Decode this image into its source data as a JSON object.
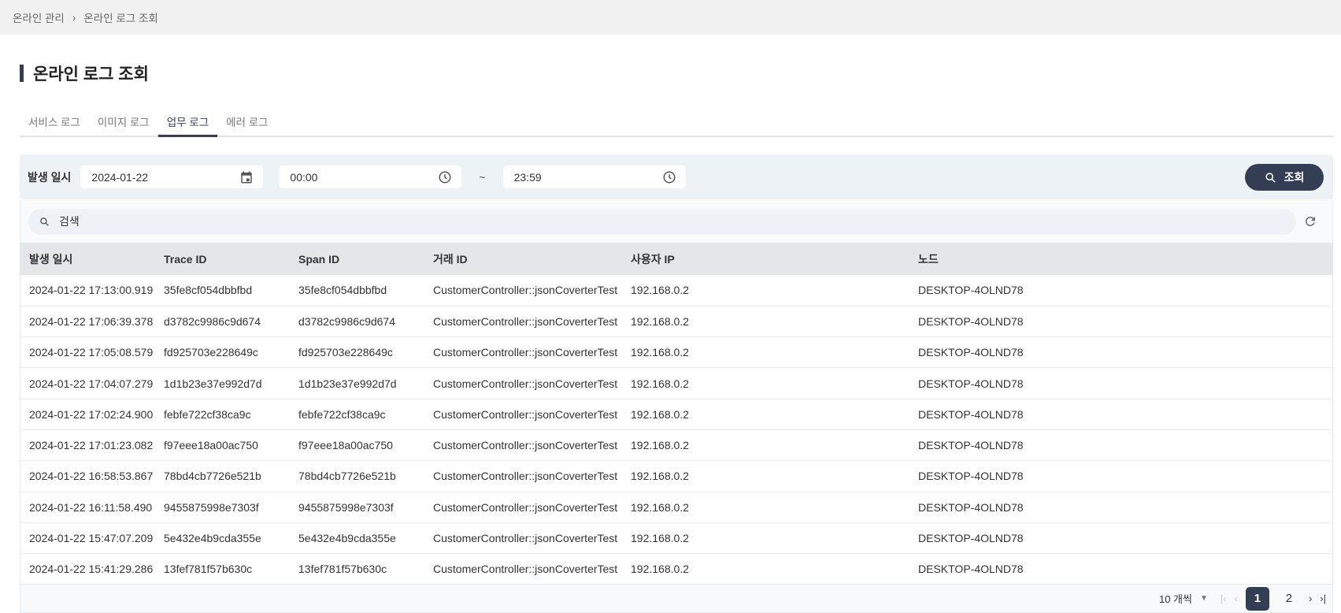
{
  "breadcrumb": {
    "parent": "온라인 관리",
    "current": "온라인 로그 조회"
  },
  "page_title": "온라인 로그 조회",
  "tabs": [
    {
      "label": "서비스 로그"
    },
    {
      "label": "이미지 로그"
    },
    {
      "label": "업무 로그",
      "active": true
    },
    {
      "label": "에러 로그"
    }
  ],
  "filter": {
    "label": "발생 일시",
    "date": "2024-01-22",
    "time_from": "00:00",
    "separator": "~",
    "time_to": "23:59",
    "search_button": "조회"
  },
  "search": {
    "placeholder": "검색"
  },
  "table": {
    "columns": [
      "발생 일시",
      "Trace ID",
      "Span ID",
      "거래 ID",
      "사용자 IP",
      "노드"
    ],
    "rows": [
      [
        "2024-01-22 17:13:00.919",
        "35fe8cf054dbbfbd",
        "35fe8cf054dbbfbd",
        "CustomerController::jsonCoverterTest",
        "192.168.0.2",
        "DESKTOP-4OLND78"
      ],
      [
        "2024-01-22 17:06:39.378",
        "d3782c9986c9d674",
        "d3782c9986c9d674",
        "CustomerController::jsonCoverterTest",
        "192.168.0.2",
        "DESKTOP-4OLND78"
      ],
      [
        "2024-01-22 17:05:08.579",
        "fd925703e228649c",
        "fd925703e228649c",
        "CustomerController::jsonCoverterTest",
        "192.168.0.2",
        "DESKTOP-4OLND78"
      ],
      [
        "2024-01-22 17:04:07.279",
        "1d1b23e37e992d7d",
        "1d1b23e37e992d7d",
        "CustomerController::jsonCoverterTest",
        "192.168.0.2",
        "DESKTOP-4OLND78"
      ],
      [
        "2024-01-22 17:02:24.900",
        "febfe722cf38ca9c",
        "febfe722cf38ca9c",
        "CustomerController::jsonCoverterTest",
        "192.168.0.2",
        "DESKTOP-4OLND78"
      ],
      [
        "2024-01-22 17:01:23.082",
        "f97eee18a00ac750",
        "f97eee18a00ac750",
        "CustomerController::jsonCoverterTest",
        "192.168.0.2",
        "DESKTOP-4OLND78"
      ],
      [
        "2024-01-22 16:58:53.867",
        "78bd4cb7726e521b",
        "78bd4cb7726e521b",
        "CustomerController::jsonCoverterTest",
        "192.168.0.2",
        "DESKTOP-4OLND78"
      ],
      [
        "2024-01-22 16:11:58.490",
        "9455875998e7303f",
        "9455875998e7303f",
        "CustomerController::jsonCoverterTest",
        "192.168.0.2",
        "DESKTOP-4OLND78"
      ],
      [
        "2024-01-22 15:47:07.209",
        "5e432e4b9cda355e",
        "5e432e4b9cda355e",
        "CustomerController::jsonCoverterTest",
        "192.168.0.2",
        "DESKTOP-4OLND78"
      ],
      [
        "2024-01-22 15:41:29.286",
        "13fef781f57b630c",
        "13fef781f57b630c",
        "CustomerController::jsonCoverterTest",
        "192.168.0.2",
        "DESKTOP-4OLND78"
      ]
    ]
  },
  "pagination": {
    "page_size": "10 개씩",
    "pages": [
      "1",
      "2"
    ],
    "current": "1"
  },
  "colors": {
    "primary": "#333e55",
    "panel": "#edf2f7"
  }
}
